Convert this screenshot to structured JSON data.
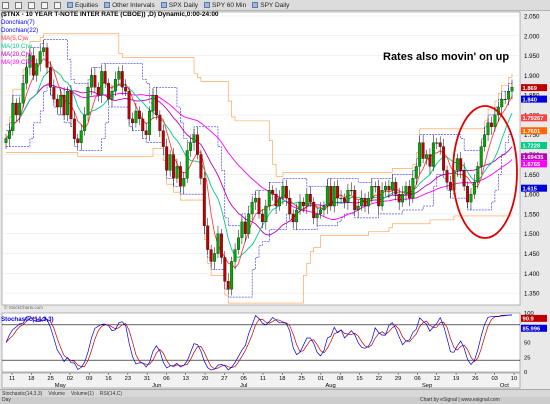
{
  "toolbar": {
    "items": [
      "Equities",
      "Other Intervals",
      "SPX Daily",
      "SPY 60 Min",
      "SPY Daily"
    ]
  },
  "colors": {
    "background": "#e9e9e9",
    "chart_bg": "#ffffff",
    "up_candle": "#00aa00",
    "down_candle": "#c00000",
    "donchian": "#0000dd",
    "ma5": "#ff4040",
    "ma10": "#00cc88",
    "ma20": "#bb00bb",
    "ma39": "#ff00ff",
    "annotation_circle": "#e00000"
  },
  "chart_data": [
    {
      "type": "candlestick",
      "title": "($TNX - 10 YEAR T-NOTE INTER RATE (CBOE)) ,D) Dynamic,0:00-24:00",
      "annotation": "Rates also movin' on up",
      "indicators": [
        "Donchian(7)",
        "Donchian(22)",
        "MA(5,C)w",
        "MA(10,C)w",
        "MA(20,C)w",
        "MA(39,C)w"
      ],
      "y_ticks": [
        "2.050",
        "2.000",
        "1.950",
        "1.900",
        "1.850",
        "1.800",
        "1.750",
        "1.700",
        "1.650",
        "1.600",
        "1.550",
        "1.500",
        "1.450",
        "1.400",
        "1.350"
      ],
      "ylim": [
        1.32,
        2.06
      ],
      "price_labels": [
        {
          "value": "1.869",
          "color": "#c00000"
        },
        {
          "value": "1.840",
          "color": "#0000dd"
        },
        {
          "value": "1.79267",
          "color": "#ff4040"
        },
        {
          "value": "1.7601",
          "color": "#ff6600"
        },
        {
          "value": "1.7228",
          "color": "#00cc88"
        },
        {
          "value": "1.69435",
          "color": "#bb00bb"
        },
        {
          "value": "1.6765",
          "color": "#ff00ff"
        },
        {
          "value": "1.615",
          "color": "#0000dd"
        }
      ],
      "close": [
        1.74,
        1.76,
        1.83,
        1.8,
        1.83,
        1.88,
        1.92,
        1.95,
        1.9,
        1.93,
        1.96,
        1.97,
        1.92,
        1.87,
        1.84,
        1.82,
        1.85,
        1.8,
        1.86,
        1.79,
        1.74,
        1.73,
        1.76,
        1.8,
        1.87,
        1.9,
        1.87,
        1.85,
        1.91,
        1.88,
        1.84,
        1.86,
        1.89,
        1.91,
        1.87,
        1.86,
        1.79,
        1.78,
        1.81,
        1.79,
        1.76,
        1.75,
        1.81,
        1.85,
        1.8,
        1.76,
        1.72,
        1.66,
        1.7,
        1.64,
        1.67,
        1.62,
        1.64,
        1.71,
        1.73,
        1.75,
        1.7,
        1.64,
        1.52,
        1.46,
        1.43,
        1.45,
        1.5,
        1.44,
        1.38,
        1.36,
        1.43,
        1.46,
        1.49,
        1.53,
        1.5,
        1.55,
        1.58,
        1.59,
        1.55,
        1.53,
        1.57,
        1.61,
        1.6,
        1.57,
        1.59,
        1.62,
        1.59,
        1.55,
        1.53,
        1.56,
        1.58,
        1.57,
        1.6,
        1.58,
        1.54,
        1.55,
        1.56,
        1.57,
        1.62,
        1.57,
        1.62,
        1.59,
        1.59,
        1.58,
        1.61,
        1.61,
        1.56,
        1.57,
        1.59,
        1.57,
        1.59,
        1.62,
        1.62,
        1.57,
        1.61,
        1.62,
        1.61,
        1.63,
        1.6,
        1.58,
        1.6,
        1.62,
        1.59,
        1.64,
        1.67,
        1.73,
        1.69,
        1.7,
        1.67,
        1.73,
        1.73,
        1.72,
        1.66,
        1.63,
        1.61,
        1.66,
        1.69,
        1.66,
        1.62,
        1.58,
        1.6,
        1.63,
        1.67,
        1.72,
        1.75,
        1.78,
        1.77,
        1.8,
        1.82,
        1.84,
        1.84,
        1.86,
        1.87
      ],
      "x_tick_labels": [
        "11",
        "18",
        "25",
        "02",
        "09",
        "16",
        "23",
        "31",
        "06",
        "13",
        "20",
        "27",
        "05",
        "11",
        "18",
        "25",
        "01",
        "08",
        "15",
        "22",
        "29",
        "06",
        "12",
        "19",
        "26",
        "03",
        "10"
      ],
      "month_labels": [
        "May",
        "Jun",
        "Jul",
        "Aug",
        "Sep",
        "Oct"
      ]
    },
    {
      "type": "line",
      "title": "Stochastic(14,3,3)",
      "y_ticks": [
        "100",
        "75",
        "50",
        "25",
        "0"
      ],
      "ylim": [
        0,
        100
      ],
      "reference_lines": [
        80,
        20
      ],
      "latest_values": [
        {
          "value": "90.9",
          "color": "#c00000"
        },
        {
          "value": "85.996",
          "color": "#0000dd"
        }
      ]
    }
  ],
  "bottom_tabs": [
    "Stochastic(14,3,3)",
    "Volume",
    "Volume(1)",
    "RSI(14,C)"
  ],
  "watermark": "© StockCharts.com",
  "footer": {
    "left": "Day",
    "right": "Chart by eSignal | www.esignal.com"
  }
}
